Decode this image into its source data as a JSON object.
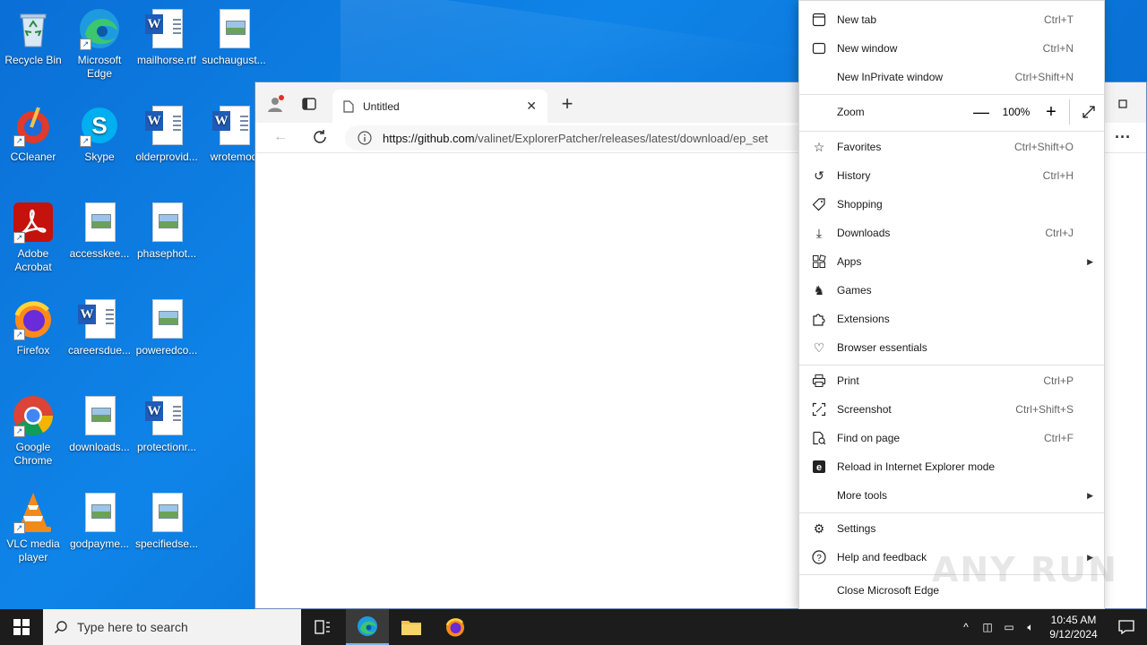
{
  "desktop": {
    "icons": [
      {
        "label": "Recycle Bin",
        "icon": "recycle-bin-icon"
      },
      {
        "label": "Microsoft Edge",
        "icon": "edge-icon"
      },
      {
        "label": "mailhorse.rtf",
        "icon": "word-doc-icon"
      },
      {
        "label": "suchaugust...",
        "icon": "image-file-icon"
      },
      {
        "label": "CCleaner",
        "icon": "ccleaner-icon"
      },
      {
        "label": "Skype",
        "icon": "skype-icon"
      },
      {
        "label": "olderprovid...",
        "icon": "word-doc-icon"
      },
      {
        "label": "wrotemod",
        "icon": "word-doc-icon"
      },
      {
        "label": "Adobe Acrobat",
        "icon": "acrobat-icon"
      },
      {
        "label": "accesskee...",
        "icon": "image-file-icon"
      },
      {
        "label": "phasephot...",
        "icon": "image-file-icon"
      },
      {
        "label": "Firefox",
        "icon": "firefox-icon"
      },
      {
        "label": "careersdue...",
        "icon": "word-doc-icon"
      },
      {
        "label": "poweredco...",
        "icon": "image-file-icon"
      },
      {
        "label": "Google Chrome",
        "icon": "chrome-icon"
      },
      {
        "label": "downloads...",
        "icon": "image-file-icon"
      },
      {
        "label": "protectionr...",
        "icon": "word-doc-icon"
      },
      {
        "label": "VLC media player",
        "icon": "vlc-icon"
      },
      {
        "label": "godpayme...",
        "icon": "image-file-icon"
      },
      {
        "label": "specifiedse...",
        "icon": "image-file-icon"
      }
    ]
  },
  "browser": {
    "tab_title": "Untitled",
    "url_host": "https://github.com",
    "url_path": "/valinet/ExplorerPatcher/releases/latest/download/ep_set"
  },
  "menu": {
    "new_tab": {
      "label": "New tab",
      "shortcut": "Ctrl+T"
    },
    "new_window": {
      "label": "New window",
      "shortcut": "Ctrl+N"
    },
    "new_inprivate": {
      "label": "New InPrivate window",
      "shortcut": "Ctrl+Shift+N"
    },
    "zoom": {
      "label": "Zoom",
      "value": "100%"
    },
    "favorites": {
      "label": "Favorites",
      "shortcut": "Ctrl+Shift+O"
    },
    "history": {
      "label": "History",
      "shortcut": "Ctrl+H"
    },
    "shopping": {
      "label": "Shopping"
    },
    "downloads": {
      "label": "Downloads",
      "shortcut": "Ctrl+J"
    },
    "apps": {
      "label": "Apps"
    },
    "games": {
      "label": "Games"
    },
    "extensions": {
      "label": "Extensions"
    },
    "browser_essentials": {
      "label": "Browser essentials"
    },
    "print": {
      "label": "Print",
      "shortcut": "Ctrl+P"
    },
    "screenshot": {
      "label": "Screenshot",
      "shortcut": "Ctrl+Shift+S"
    },
    "find": {
      "label": "Find on page",
      "shortcut": "Ctrl+F"
    },
    "ie_mode": {
      "label": "Reload in Internet Explorer mode"
    },
    "more_tools": {
      "label": "More tools"
    },
    "settings": {
      "label": "Settings"
    },
    "help": {
      "label": "Help and feedback"
    },
    "close": {
      "label": "Close Microsoft Edge"
    }
  },
  "taskbar": {
    "search_placeholder": "Type here to search",
    "time": "10:45 AM",
    "date": "9/12/2024"
  },
  "watermark": "ANY RUN"
}
